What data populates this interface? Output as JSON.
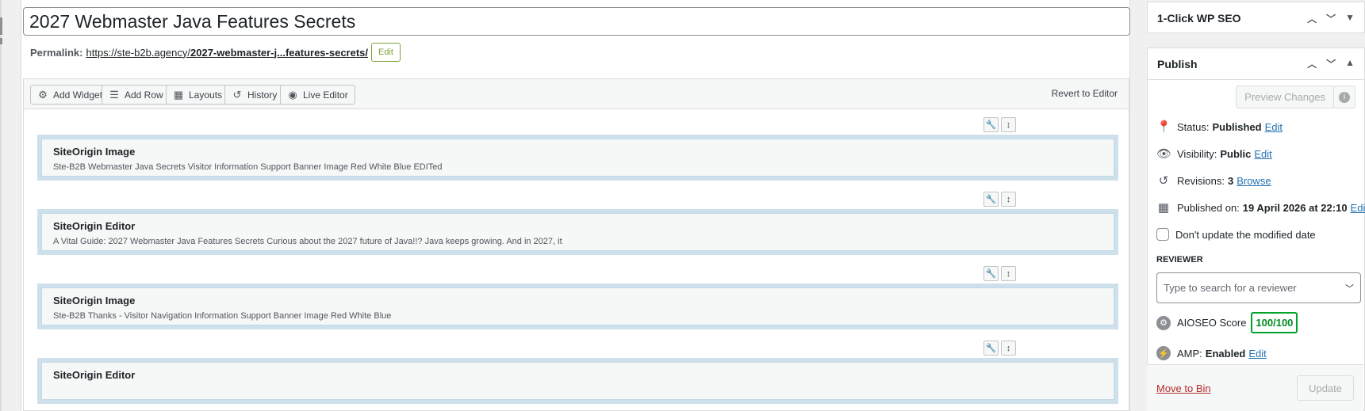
{
  "post": {
    "title": "2027 Webmaster Java Features Secrets",
    "permalink_label": "Permalink:",
    "permalink_base": "https://ste-b2b.agency/",
    "permalink_slug": "2027-webmaster-j...features-secrets/",
    "permalink_edit": "Edit"
  },
  "toolbar": {
    "add_widget": "Add Widget",
    "add_row": "Add Row",
    "layouts": "Layouts",
    "history": "History",
    "live_editor": "Live Editor",
    "revert": "Revert to Editor"
  },
  "widgets": [
    {
      "title": "SiteOrigin Image",
      "desc": "Ste-B2B Webmaster Java Secrets Visitor Information Support Banner Image Red White Blue EDITed"
    },
    {
      "title": "SiteOrigin Editor",
      "desc": "A Vital Guide: 2027 Webmaster Java Features Secrets Curious about the 2027 future of Java!!? Java keeps growing. And in 2027, it"
    },
    {
      "title": "SiteOrigin Image",
      "desc": "Ste-B2B Thanks - Visitor Navigation Information Support Banner Image Red White Blue"
    },
    {
      "title": "SiteOrigin Editor",
      "desc": ""
    }
  ],
  "sidebar": {
    "seo_box_title": "1-Click WP SEO",
    "publish_title": "Publish",
    "preview_changes": "Preview Changes",
    "status_label": "Status:",
    "status_value": "Published",
    "visibility_label": "Visibility:",
    "visibility_value": "Public",
    "revisions_label": "Revisions:",
    "revisions_value": "3",
    "browse": "Browse",
    "published_label": "Published on:",
    "published_value": "19 April 2026 at 22:10",
    "edit": "Edit",
    "dont_update": "Don't update the modified date",
    "reviewer_label": "REVIEWER",
    "reviewer_placeholder": "Type to search for a reviewer",
    "aioseo_label": "AIOSEO Score",
    "aioseo_score": "100/100",
    "amp_label": "AMP:",
    "amp_value": "Enabled",
    "move_to_bin": "Move to Bin",
    "update": "Update"
  }
}
